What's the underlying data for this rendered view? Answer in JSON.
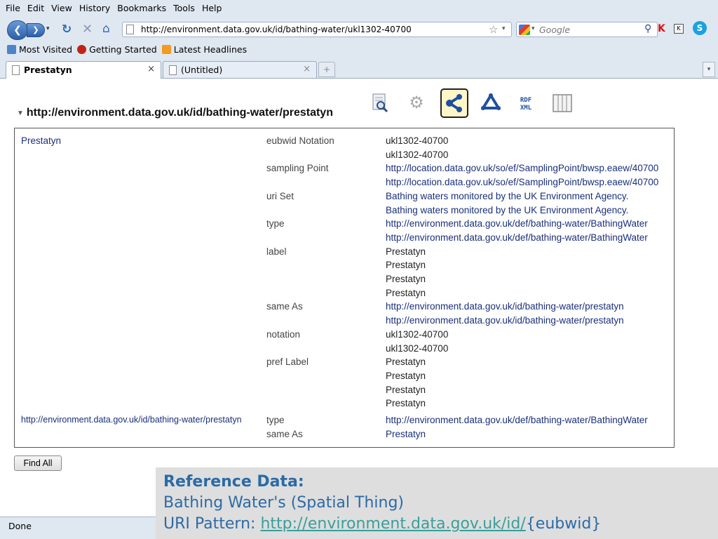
{
  "menu": [
    "File",
    "Edit",
    "View",
    "History",
    "Bookmarks",
    "Tools",
    "Help"
  ],
  "nav": {
    "url": "http://environment.data.gov.uk/id/bathing-water/ukl1302-40700",
    "search_placeholder": "Google"
  },
  "bookmarks": [
    "Most Visited",
    "Getting Started",
    "Latest Headlines"
  ],
  "tabs": [
    {
      "label": "Prestatyn",
      "active": true
    },
    {
      "label": "(Untitled)",
      "active": false
    }
  ],
  "resource": {
    "heading": "http://environment.data.gov.uk/id/bathing-water/prestatyn"
  },
  "view_icons": [
    "search-view",
    "settings-view",
    "graph-view",
    "rdf-graph-view",
    "rdf-xml-view",
    "table-view"
  ],
  "table": {
    "subject1": "Prestatyn",
    "rows1": [
      {
        "pred": "eubwid Notation",
        "values": [
          "ukl1302-40700",
          "ukl1302-40700"
        ],
        "link": false
      },
      {
        "pred": "sampling Point",
        "values": [
          "http://location.data.gov.uk/so/ef/SamplingPoint/bwsp.eaew/40700",
          "http://location.data.gov.uk/so/ef/SamplingPoint/bwsp.eaew/40700"
        ],
        "link": true
      },
      {
        "pred": "uri Set",
        "values": [
          "Bathing waters monitored by the UK Environment Agency.",
          "Bathing waters monitored by the UK Environment Agency."
        ],
        "link": true
      },
      {
        "pred": "type",
        "values": [
          "http://environment.data.gov.uk/def/bathing-water/BathingWater",
          "http://environment.data.gov.uk/def/bathing-water/BathingWater"
        ],
        "link": true
      },
      {
        "pred": "label",
        "values": [
          "Prestatyn",
          "Prestatyn",
          "Prestatyn",
          "Prestatyn"
        ],
        "link": false
      },
      {
        "pred": "same As",
        "values": [
          "http://environment.data.gov.uk/id/bathing-water/prestatyn",
          "http://environment.data.gov.uk/id/bathing-water/prestatyn"
        ],
        "link": true
      },
      {
        "pred": "notation",
        "values": [
          "ukl1302-40700",
          "ukl1302-40700"
        ],
        "link": false
      },
      {
        "pred": "pref Label",
        "values": [
          "Prestatyn",
          "Prestatyn",
          "Prestatyn",
          "Prestatyn"
        ],
        "link": false
      }
    ],
    "subject2": "http://environment.data.gov.uk/id/bathing-water/prestatyn",
    "rows2": [
      {
        "pred": "type",
        "values": [
          "http://environment.data.gov.uk/def/bathing-water/BathingWater"
        ],
        "link": true
      },
      {
        "pred": "same As",
        "values": [
          "Prestatyn"
        ],
        "link": true
      }
    ]
  },
  "find_all_label": "Find All",
  "status": "Done",
  "caption": {
    "title": "Reference Data:",
    "line1": "Bathing Water's (Spatial Thing)",
    "line2_prefix": "URI Pattern: ",
    "line2_link": "http://environment.data.gov.uk/id/",
    "line2_suffix": "{eubwid}"
  },
  "colors": {
    "chrome": "#dfe7f1",
    "link": "#1a2f7a",
    "caption_text": "#2b6aa6",
    "caption_link": "#3a9e9a"
  }
}
